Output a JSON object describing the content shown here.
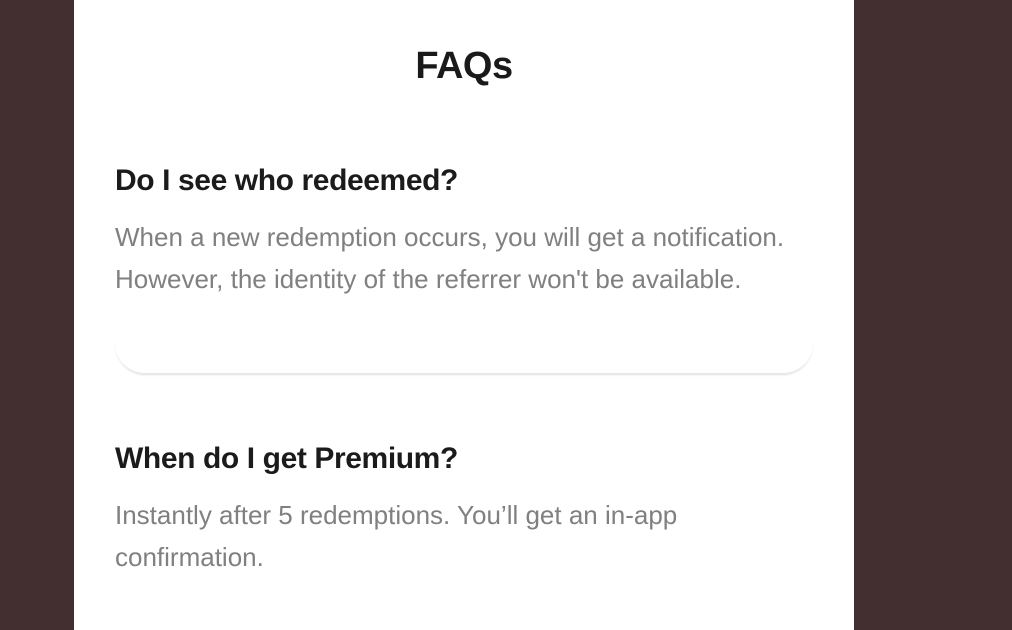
{
  "page": {
    "title": "FAQs"
  },
  "faqs": [
    {
      "question": "Do I see who redeemed?",
      "answer": "When a new redemption occurs, you will get a notification. However, the identity of the referrer won't be available."
    },
    {
      "question": "When do I get Premium?",
      "answer": "Instantly after 5 redemptions. You’ll get an in-app confirmation."
    }
  ],
  "colors": {
    "backdrop": "#432f2f",
    "panel": "#ffffff",
    "heading": "#1b1b1b",
    "body_text": "#808080"
  }
}
